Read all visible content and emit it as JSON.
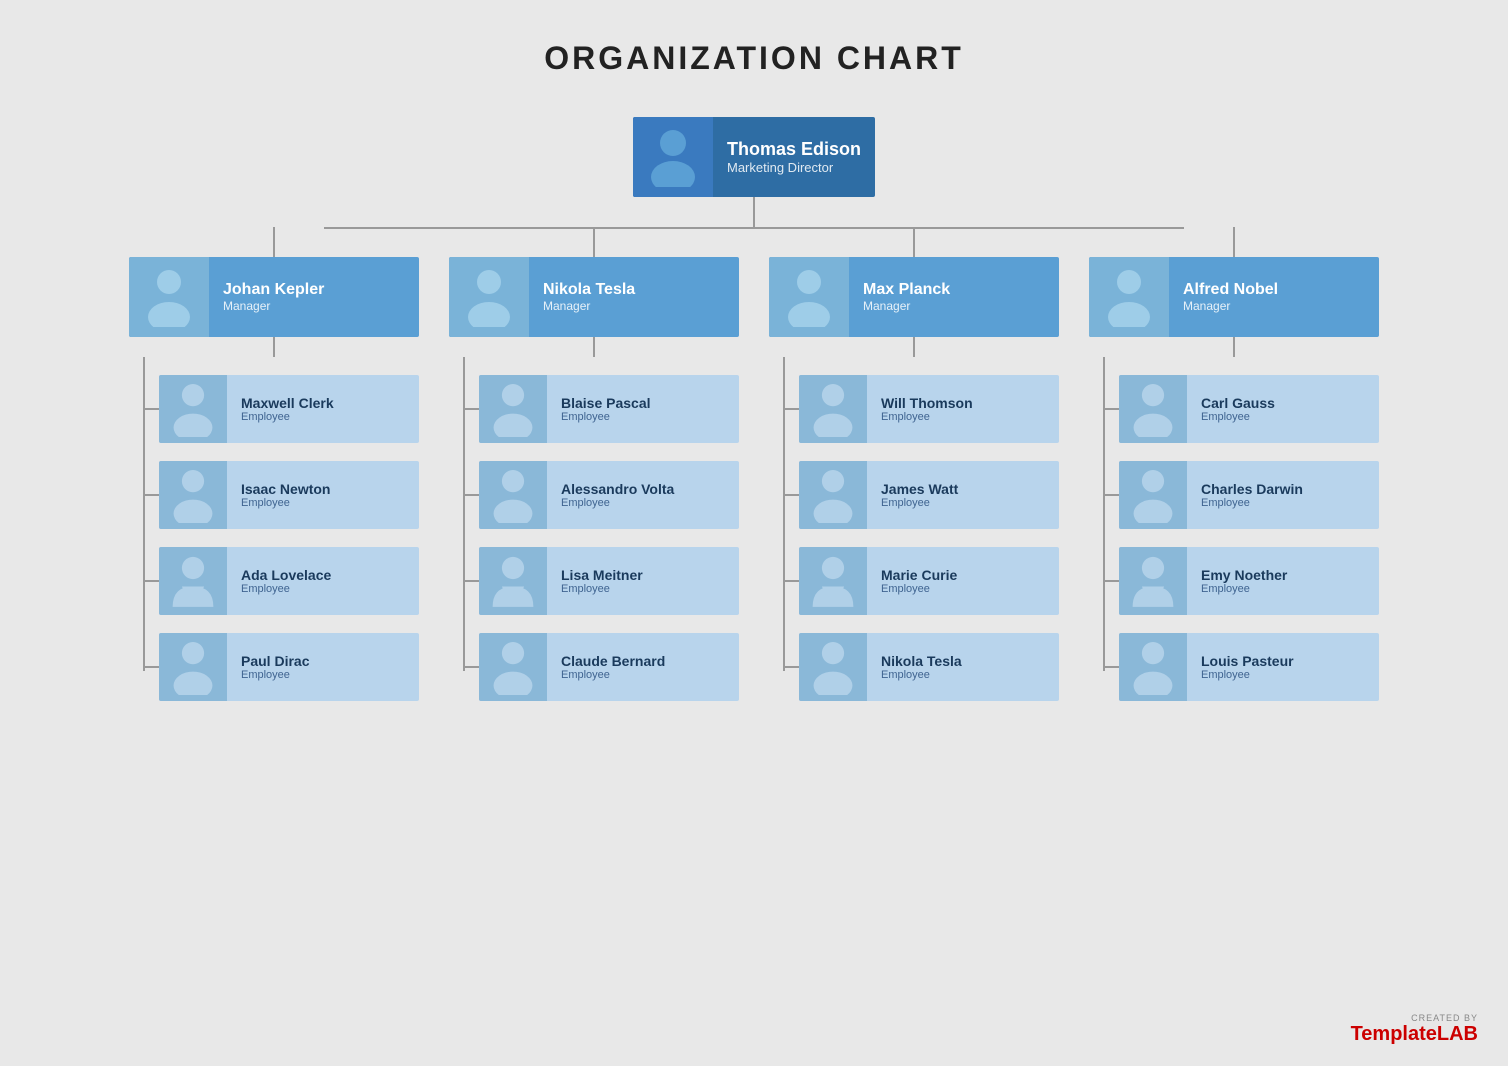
{
  "title": "ORGANIZATION CHART",
  "root": {
    "name": "Thomas Edison",
    "role": "Marketing Director"
  },
  "managers": [
    {
      "name": "Johan Kepler",
      "role": "Manager",
      "employees": [
        {
          "name": "Maxwell Clerk",
          "role": "Employee"
        },
        {
          "name": "Isaac Newton",
          "role": "Employee"
        },
        {
          "name": "Ada Lovelace",
          "role": "Employee"
        },
        {
          "name": "Paul Dirac",
          "role": "Employee"
        }
      ]
    },
    {
      "name": "Nikola Tesla",
      "role": "Manager",
      "employees": [
        {
          "name": "Blaise Pascal",
          "role": "Employee"
        },
        {
          "name": "Alessandro Volta",
          "role": "Employee"
        },
        {
          "name": "Lisa Meitner",
          "role": "Employee"
        },
        {
          "name": "Claude Bernard",
          "role": "Employee"
        }
      ]
    },
    {
      "name": "Max Planck",
      "role": "Manager",
      "employees": [
        {
          "name": "Will Thomson",
          "role": "Employee"
        },
        {
          "name": "James Watt",
          "role": "Employee"
        },
        {
          "name": "Marie Curie",
          "role": "Employee"
        },
        {
          "name": "Nikola Tesla",
          "role": "Employee"
        }
      ]
    },
    {
      "name": "Alfred Nobel",
      "role": "Manager",
      "employees": [
        {
          "name": "Carl Gauss",
          "role": "Employee"
        },
        {
          "name": "Charles Darwin",
          "role": "Employee"
        },
        {
          "name": "Emy Noether",
          "role": "Employee"
        },
        {
          "name": "Louis Pasteur",
          "role": "Employee"
        }
      ]
    }
  ],
  "watermark": {
    "created_by": "CREATED BY",
    "brand_normal": "Template",
    "brand_highlight": "LAB"
  }
}
